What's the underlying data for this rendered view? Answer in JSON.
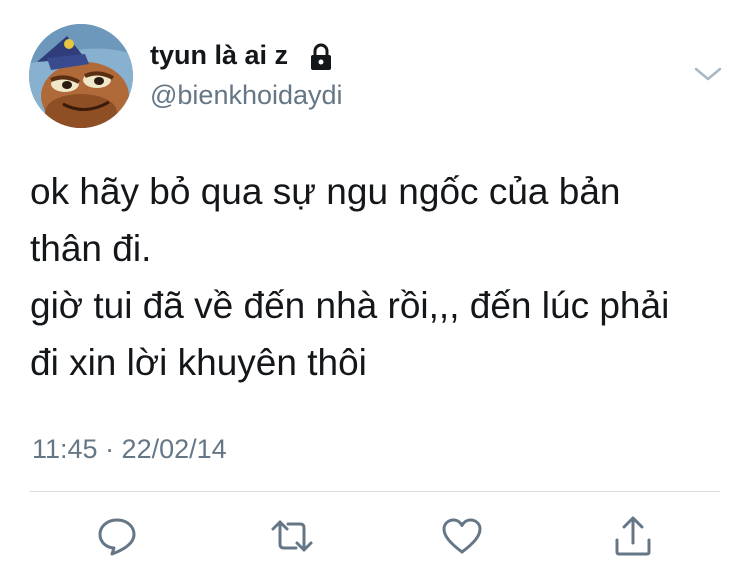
{
  "user": {
    "display_name": "tyun là ai z",
    "handle": "@bienkhoidaydi"
  },
  "tweet": {
    "lines": [
      "ok hãy bỏ qua sự ngu ngốc của bản",
      "thân đi.",
      "giờ tui đã về đến nhà rồi,,, đến lúc phải",
      "đi xin lời khuyên thôi"
    ],
    "timestamp": "11:45 · 22/02/14"
  },
  "icons": {
    "lock": "lock-icon",
    "menu": "chevron-down-icon",
    "actions": [
      "reply-icon",
      "retweet-icon",
      "like-icon",
      "share-icon"
    ]
  },
  "colors": {
    "text": "#14171a",
    "secondary": "#657786",
    "icon": "#657786",
    "divider": "#d6dbe0"
  }
}
